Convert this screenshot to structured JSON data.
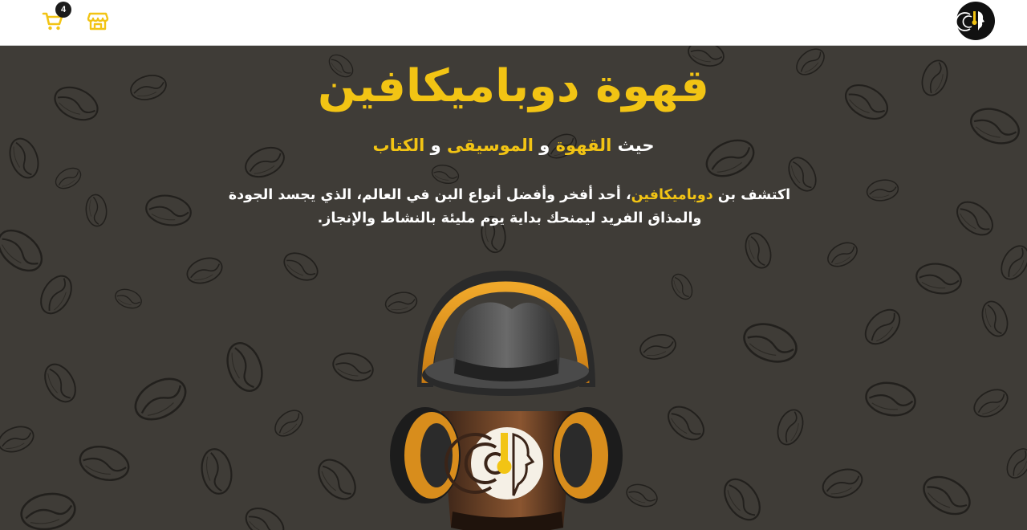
{
  "header": {
    "cart_count": "4",
    "cart_icon": "cart-icon",
    "store_icon": "store-icon",
    "logo_icon": "brand-logo-icon"
  },
  "hero": {
    "title": "قهوة دوباميكافين",
    "tagline": {
      "part1": "حيث ",
      "coffee": "القهوة",
      "and1": " و ",
      "music": "الموسيقى",
      "and2": " و ",
      "books": "الكتاب"
    },
    "description": {
      "lead": "اكتشف بن ",
      "brand": "دوباميكافين",
      "rest": "، أحد أفخر وأفضل أنواع البن في العالم، الذي يجسد الجودة والمذاق الفريد ليمنحك بداية يوم مليئة بالنشاط والإنجاز."
    },
    "mascot_icon": "coffee-cup-headphones-mascot"
  },
  "colors": {
    "accent": "#f2c414",
    "background": "#3f3c37",
    "header": "#ffffff"
  }
}
